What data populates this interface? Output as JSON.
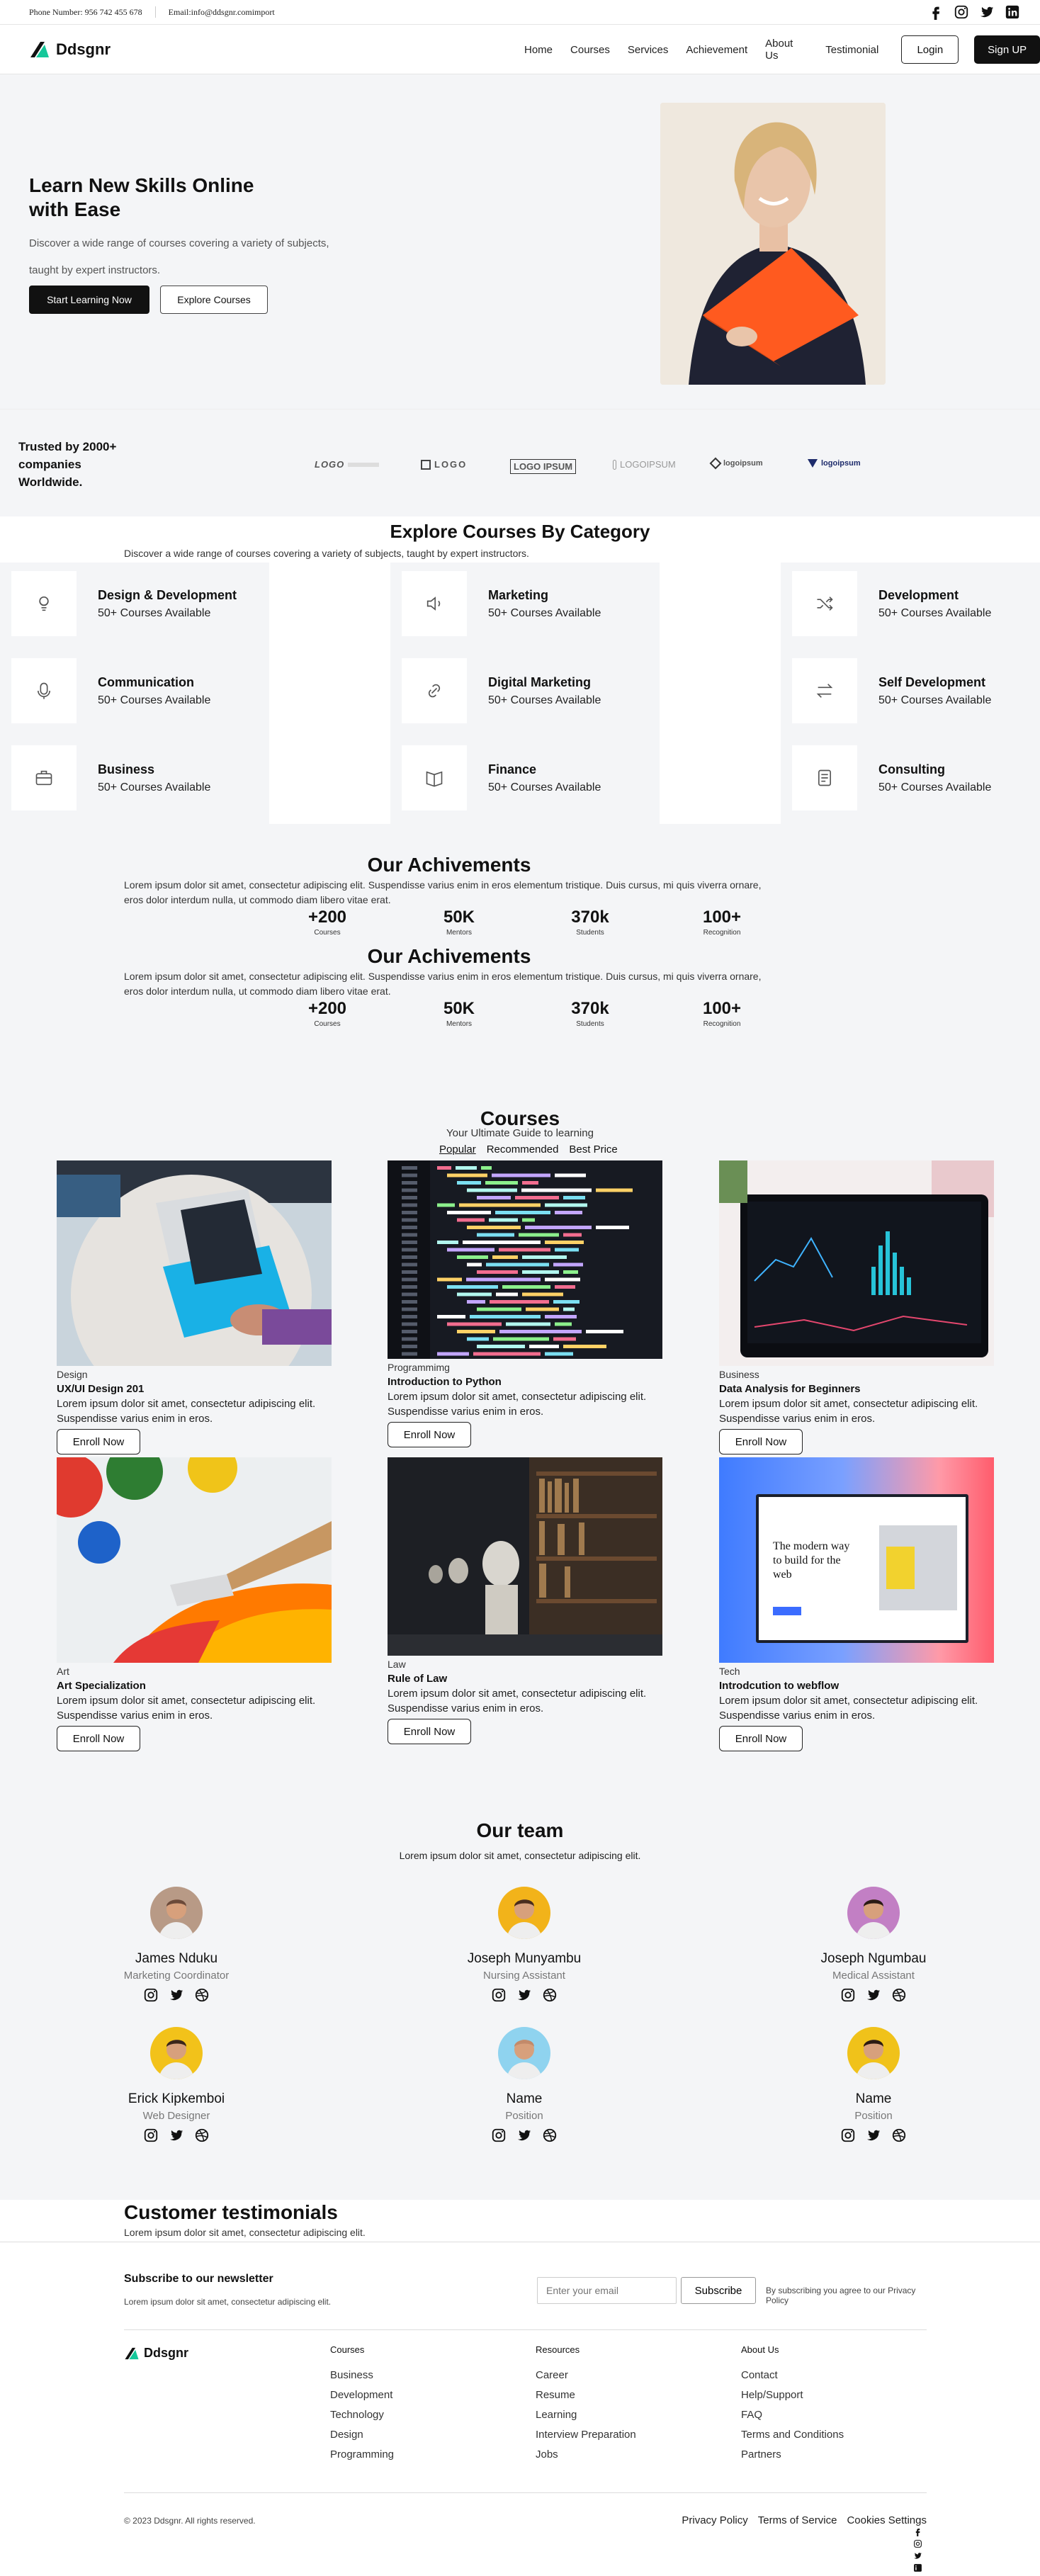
{
  "topbar": {
    "phone": "Phone Number: 956 742 455 678",
    "email": "Email:info@ddsgnr.comimport",
    "social_icons": [
      "facebook-icon",
      "instagram-icon",
      "twitter-icon",
      "linkedin-icon"
    ]
  },
  "nav": {
    "brand": "Ddsgnr",
    "links": [
      "Home",
      "Courses",
      "Services",
      "Achievement",
      "About Us",
      "Testimonial"
    ],
    "login": "Login",
    "signup": "Sign UP"
  },
  "hero": {
    "title": "Learn New Skills Online with Ease",
    "description": "Discover a wide range of courses covering a variety of subjects, taught by expert instructors.",
    "primary_cta": "Start Learning Now",
    "secondary_cta": "Explore Courses"
  },
  "trusted": {
    "text": "Trusted by 2000+ companies Worldwide.",
    "logos": [
      "LOGO",
      "LOGO",
      "LOGO IPSUM",
      "LOGOIPSUM",
      "logoipsum",
      "logoipsum"
    ]
  },
  "categories": {
    "title": "Explore Courses By Category",
    "subtitle": "Discover a wide range of courses covering a variety of subjects, taught by expert instructors.",
    "items": [
      {
        "title": "Design & Development",
        "count": "50+ Courses Available",
        "icon": "design-icon"
      },
      {
        "title": "Communication",
        "count": "50+ Courses Available",
        "icon": "microphone-icon"
      },
      {
        "title": "Business",
        "count": "50+ Courses Available",
        "icon": "briefcase-icon"
      },
      {
        "title": "Marketing",
        "count": "50+ Courses Available",
        "icon": "speaker-icon"
      },
      {
        "title": "Digital Marketing",
        "count": "50+ Courses Available",
        "icon": "link-icon"
      },
      {
        "title": "Finance",
        "count": "50+ Courses Available",
        "icon": "book-icon"
      },
      {
        "title": "Development",
        "count": "50+ Courses Available",
        "icon": "shuffle-icon"
      },
      {
        "title": "Self Development",
        "count": "50+ Courses Available",
        "icon": "arrows-icon"
      },
      {
        "title": "Consulting",
        "count": "50+ Courses Available",
        "icon": "document-icon"
      }
    ]
  },
  "achievements": [
    {
      "title": "Our Achivements",
      "text": "Lorem ipsum dolor sit amet, consectetur adipiscing elit. Suspendisse varius enim in eros elementum tristique. Duis cursus, mi quis viverra ornare, eros dolor interdum nulla, ut commodo diam libero vitae erat.",
      "stats": [
        {
          "value": "+200",
          "label": "Courses"
        },
        {
          "value": "50K",
          "label": "Mentors"
        },
        {
          "value": "370k",
          "label": "Students"
        },
        {
          "value": "100+",
          "label": "Recognition"
        }
      ]
    },
    {
      "title": "Our Achivements",
      "text": "Lorem ipsum dolor sit amet, consectetur adipiscing elit. Suspendisse varius enim in eros elementum tristique. Duis cursus, mi quis viverra ornare, eros dolor interdum nulla, ut commodo diam libero vitae erat.",
      "stats": [
        {
          "value": "+200",
          "label": "Courses"
        },
        {
          "value": "50K",
          "label": "Mentors"
        },
        {
          "value": "370k",
          "label": "Students"
        },
        {
          "value": "100+",
          "label": "Recognition"
        }
      ]
    }
  ],
  "courses": {
    "title": "Courses",
    "subtitle": "Your Ultimate Guide to learning",
    "tabs": [
      "Popular",
      "Recommended",
      "Best Price"
    ],
    "items": [
      {
        "category": "Design",
        "title": "UX/UI Design 201",
        "desc": "Lorem ipsum dolor sit amet, consectetur adipiscing elit. Suspendisse varius enim in eros.",
        "cta": "Enroll Now"
      },
      {
        "category": "Programmimg",
        "title": "Introduction to Python",
        "desc": "Lorem ipsum dolor sit amet, consectetur adipiscing elit. Suspendisse varius enim in eros.",
        "cta": "Enroll Now"
      },
      {
        "category": "Business",
        "title": "Data Analysis for Beginners",
        "desc": "Lorem ipsum dolor sit amet, consectetur adipiscing elit. Suspendisse varius enim in eros.",
        "cta": "Enroll Now"
      },
      {
        "category": "Art",
        "title": "Art Specialization",
        "desc": "Lorem ipsum dolor sit amet, consectetur adipiscing elit. Suspendisse varius enim in eros.",
        "cta": "Enroll Now"
      },
      {
        "category": "Law",
        "title": "Rule of Law",
        "desc": "Lorem ipsum dolor sit amet, consectetur adipiscing elit. Suspendisse varius enim in eros.",
        "cta": "Enroll Now"
      },
      {
        "category": "Tech",
        "title": "Introdcution to webflow",
        "desc": "Lorem ipsum dolor sit amet, consectetur adipiscing elit. Suspendisse varius enim in eros.",
        "cta": "Enroll Now"
      }
    ],
    "webflow_mock_text": "The modern way to build for the web"
  },
  "team": {
    "title": "Our team",
    "subtitle": "Lorem ipsum dolor sit amet, consectetur adipiscing elit.",
    "members": [
      {
        "name": "James Nduku",
        "position": "Marketing Coordinator"
      },
      {
        "name": "Joseph Munyambu",
        "position": "Nursing Assistant"
      },
      {
        "name": "Joseph Ngumbau",
        "position": "Medical Assistant"
      },
      {
        "name": "Erick Kipkemboi",
        "position": "Web Designer"
      },
      {
        "name": "Name",
        "position": "Position"
      },
      {
        "name": "Name",
        "position": "Position"
      }
    ]
  },
  "testimonials": {
    "title": "Customer testimonials",
    "subtitle": "Lorem ipsum dolor sit amet, consectetur adipiscing elit."
  },
  "newsletter": {
    "title": "Subscribe to our newsletter",
    "subtitle": "Lorem ipsum dolor sit amet, consectetur adipiscing elit.",
    "placeholder": "Enter your email",
    "button": "Subscribe",
    "note": "By subscribing you agree to our Privacy Policy"
  },
  "footer": {
    "brand": "Ddsgnr",
    "columns": [
      {
        "title": "Courses",
        "links": [
          "Business",
          "Development",
          "Technology",
          "Design",
          "Programming"
        ]
      },
      {
        "title": "Resources",
        "links": [
          "Career",
          "Resume",
          "Learning",
          "Interview Preparation",
          "Jobs"
        ]
      },
      {
        "title": "About Us",
        "links": [
          "Contact",
          "Help/Support",
          "FAQ",
          "Terms and Conditions",
          "Partners"
        ]
      }
    ],
    "copyright": "© 2023 Ddsgnr. All rights reserved.",
    "legal": [
      "Privacy Policy",
      "Terms of Service",
      "Cookies Settings"
    ]
  }
}
